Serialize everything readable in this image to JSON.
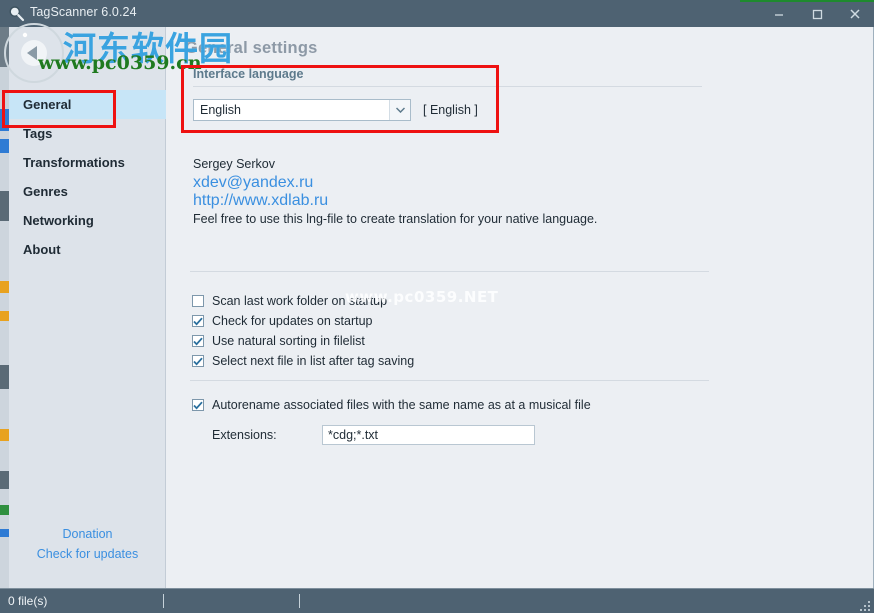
{
  "window": {
    "title": "TagScanner 6.0.24",
    "icon": "magnifier-icon",
    "minimize_label": "Minimize",
    "maximize_label": "Maximize",
    "close_label": "Close"
  },
  "sidebar": {
    "items": [
      {
        "label": "General",
        "selected": true
      },
      {
        "label": "Tags",
        "selected": false
      },
      {
        "label": "Transformations",
        "selected": false
      },
      {
        "label": "Genres",
        "selected": false
      },
      {
        "label": "Networking",
        "selected": false
      },
      {
        "label": "About",
        "selected": false
      }
    ],
    "links": [
      {
        "label": "Donation"
      },
      {
        "label": "Check for updates"
      }
    ]
  },
  "content": {
    "page_title": "General settings",
    "language_group": {
      "title": "Interface language",
      "selected": "English",
      "native_name": "[ English ]",
      "dropdown_icon": "chevron-down-icon"
    },
    "author": {
      "name": "Sergey Serkov",
      "email": "xdev@yandex.ru",
      "website": "http://www.xdlab.ru",
      "note": "Feel free to use this lng-file to create translation for your native language."
    },
    "options": [
      {
        "label": "Scan last work folder on startup",
        "checked": false
      },
      {
        "label": "Check for updates on startup",
        "checked": true
      },
      {
        "label": "Use natural sorting in filelist",
        "checked": true
      },
      {
        "label": "Select next file in list after tag saving",
        "checked": true
      }
    ],
    "autorename": {
      "label": "Autorename associated files with the same name as at a musical file",
      "checked": true,
      "extensions_label": "Extensions:",
      "extensions_value": "*cdg;*.txt"
    }
  },
  "statusbar": {
    "files": "0 file(s)"
  },
  "watermarks": {
    "chinese": "河东软件园",
    "url": "www.pc0359.cn",
    "faint": "www.pc0359.NET"
  },
  "colors": {
    "titlebar": "#4e6272",
    "sidebar": "#dde3ea",
    "content": "#eceff3",
    "selection": "#c7e5f7",
    "link": "#3a8fe0",
    "highlight_box": "#ee1111",
    "accent_green": "#1e8a2e"
  }
}
